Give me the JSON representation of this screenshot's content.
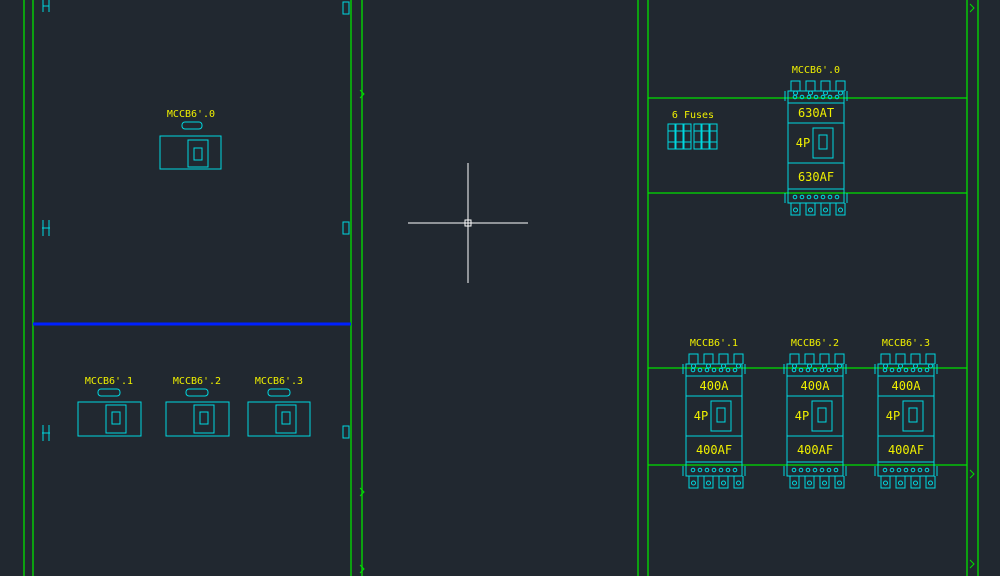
{
  "colors": {
    "background": "#212830",
    "frame": "#00e000",
    "device": "#00d8e0",
    "label": "#f0f000",
    "divider": "#0020ff",
    "crosshair": "#ffffff"
  },
  "left_panel": {
    "main_breaker_tag": "MCCB6'.0",
    "branch_breaker_tags": [
      "MCCB6'.1",
      "MCCB6'.2",
      "MCCB6'.3"
    ]
  },
  "right_panel": {
    "fuses_label": "6 Fuses",
    "main_breaker": {
      "tag": "MCCB6'.0",
      "trip_rating": "630AT",
      "poles": "4P",
      "frame_rating": "630AF"
    },
    "branch_breakers": [
      {
        "tag": "MCCB6'.1",
        "trip_rating": "400A",
        "poles": "4P",
        "frame_rating": "400AF"
      },
      {
        "tag": "MCCB6'.2",
        "trip_rating": "400A",
        "poles": "4P",
        "frame_rating": "400AF"
      },
      {
        "tag": "MCCB6'.3",
        "trip_rating": "400A",
        "poles": "4P",
        "frame_rating": "400AF"
      }
    ]
  },
  "cursor": {
    "type": "crosshair-icon"
  }
}
